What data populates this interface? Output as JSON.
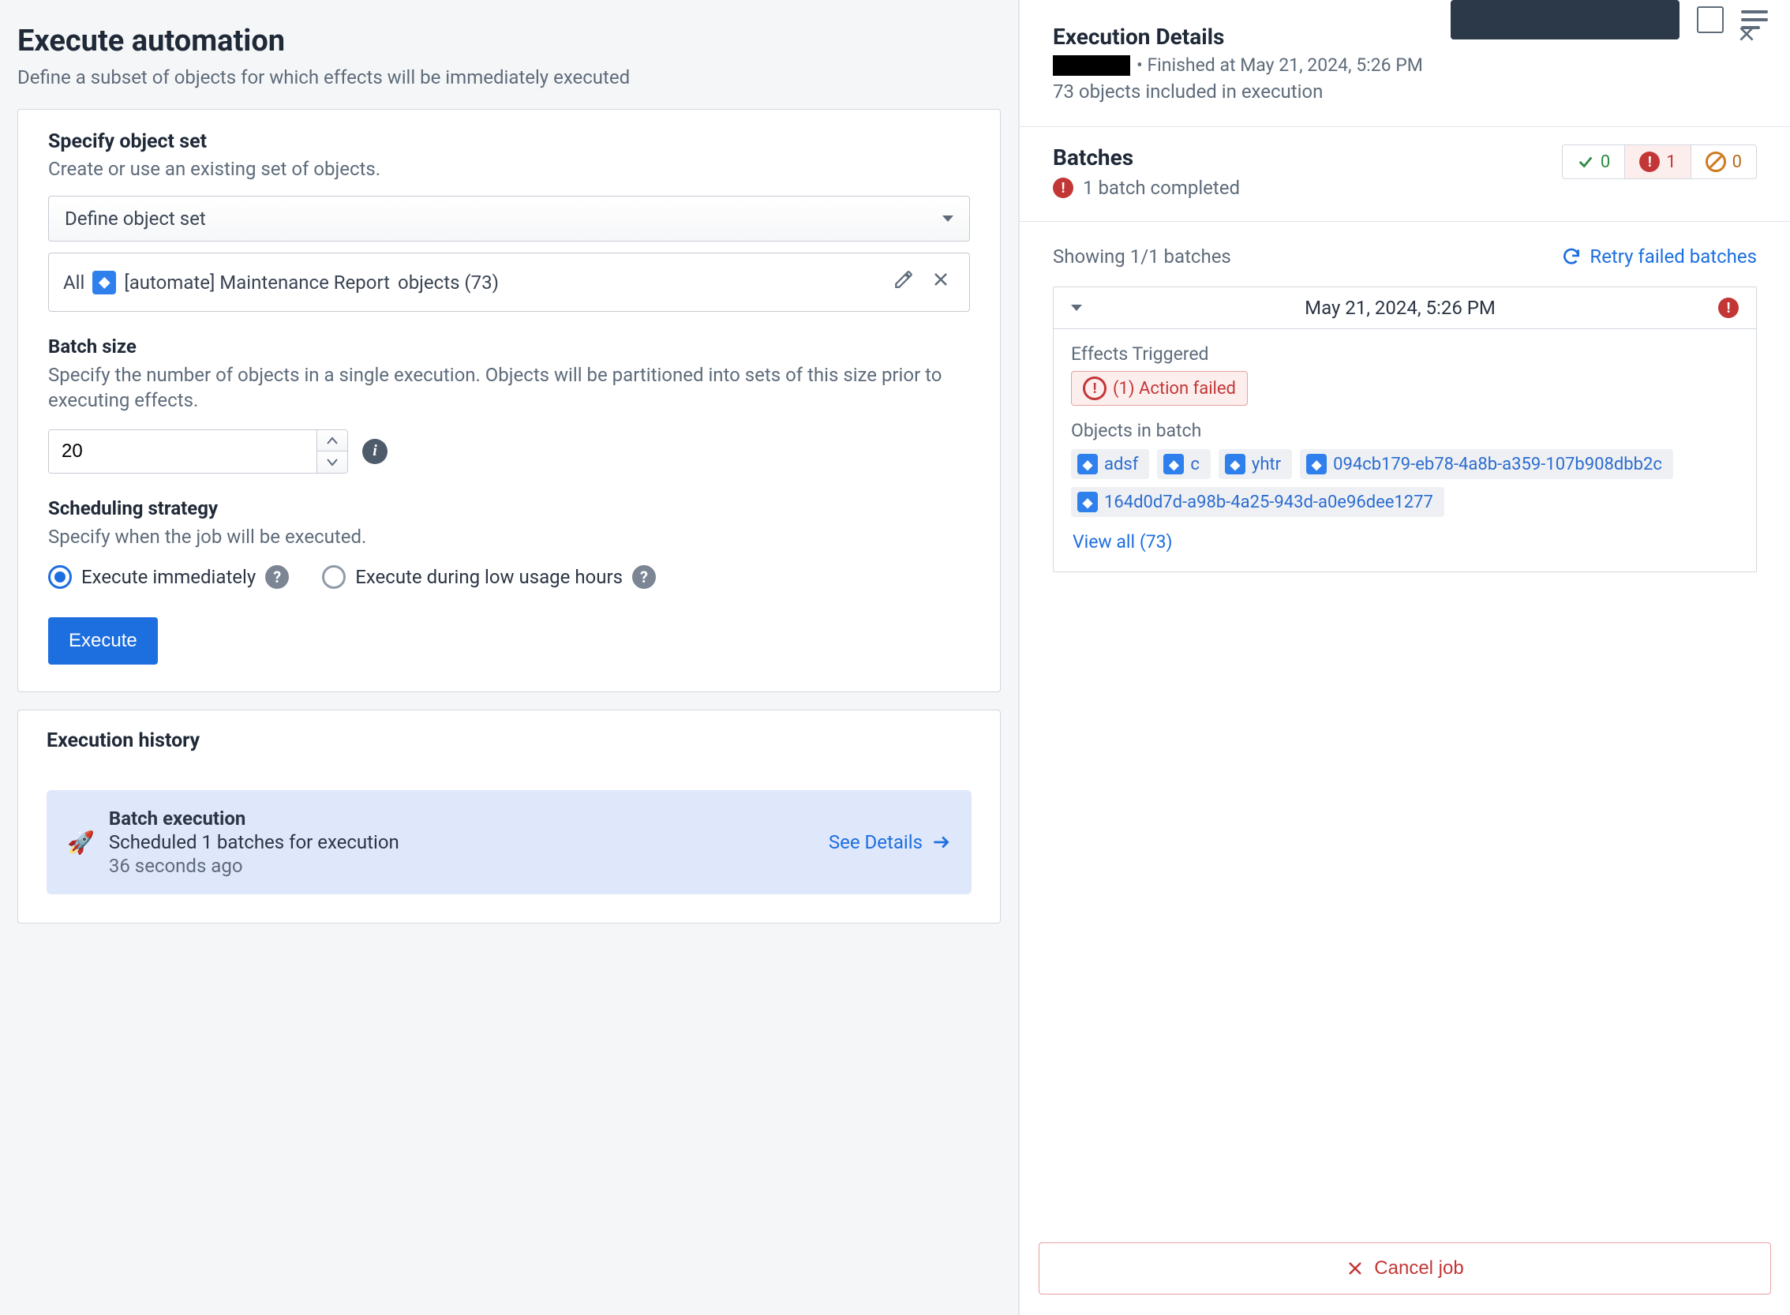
{
  "page": {
    "title": "Execute automation",
    "subtitle": "Define a subset of objects for which effects will be immediately executed"
  },
  "objectSet": {
    "sectionTitle": "Specify object set",
    "sectionSub": "Create or use an existing set of objects.",
    "selectorLabel": "Define object set",
    "allLabel": "All",
    "typeName": "[automate] Maintenance Report",
    "objectsLabel": "objects (73)"
  },
  "batchSize": {
    "label": "Batch size",
    "desc": "Specify the number of objects in a single execution. Objects will be partitioned into sets of this size prior to executing effects.",
    "value": "20"
  },
  "scheduling": {
    "label": "Scheduling strategy",
    "desc": "Specify when the job will be executed.",
    "opt1": "Execute immediately",
    "opt2": "Execute during low usage hours"
  },
  "actions": {
    "execute": "Execute"
  },
  "history": {
    "title": "Execution history",
    "item": {
      "title": "Batch execution",
      "sub": "Scheduled 1 batches for execution",
      "time": "36 seconds ago",
      "seeDetails": "See Details"
    }
  },
  "details": {
    "title": "Execution Details",
    "finished": "• Finished at May 21, 2024, 5:26 PM",
    "objCount": "73 objects included in execution",
    "batchesTitle": "Batches",
    "batchesSub": "1 batch completed",
    "pills": {
      "ok": "0",
      "err": "1",
      "skip": "0"
    },
    "showing": "Showing 1/1 batches",
    "retry": "Retry failed batches",
    "batch": {
      "date": "May 21, 2024, 5:26 PM",
      "effTitle": "Effects Triggered",
      "effBadge": "(1) Action failed",
      "objTitle": "Objects in batch",
      "chips": [
        "adsf",
        "c",
        "yhtr",
        "094cb179-eb78-4a8b-a359-107b908dbb2c",
        "164d0d7d-a98b-4a25-943d-a0e96dee1277"
      ],
      "viewAll": "View all (73)"
    },
    "cancel": "Cancel job"
  }
}
